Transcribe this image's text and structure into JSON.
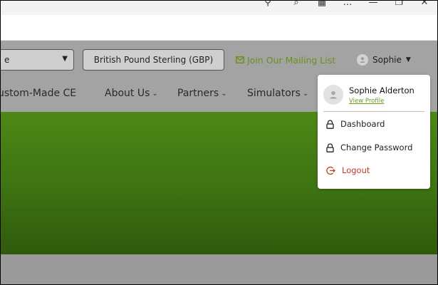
{
  "browser": {
    "icons": [
      "key-icon",
      "zoom-icon",
      "extensions-icon",
      "more-icon",
      "minimize-icon",
      "restore-icon",
      "close-icon"
    ],
    "glyphs": [
      "⚲",
      "⌕",
      "▦",
      "…",
      "—",
      "❐",
      "✕"
    ]
  },
  "topbar": {
    "language_value": "e",
    "currency_label": "British Pound Sterling (GBP)",
    "mailing_label": "Join Our Mailing List",
    "user_label": "Sophie"
  },
  "nav": {
    "items": [
      {
        "label": "ustom-Made CE",
        "has_chevron": false
      },
      {
        "label": "About Us",
        "has_chevron": true
      },
      {
        "label": "Partners",
        "has_chevron": true
      },
      {
        "label": "Simulators",
        "has_chevron": true
      }
    ]
  },
  "user_menu": {
    "name": "Sophie Alderton",
    "view_profile": "View Profile",
    "items": [
      {
        "label": "Dashboard",
        "icon": "lock-icon"
      },
      {
        "label": "Change Password",
        "icon": "lock-icon"
      },
      {
        "label": "Logout",
        "icon": "logout-icon"
      }
    ]
  },
  "colors": {
    "accent_green": "#6b8f1d",
    "logout_red": "#c23a2b",
    "hero_top": "#4d8816",
    "hero_bottom": "#2f5a0c"
  }
}
